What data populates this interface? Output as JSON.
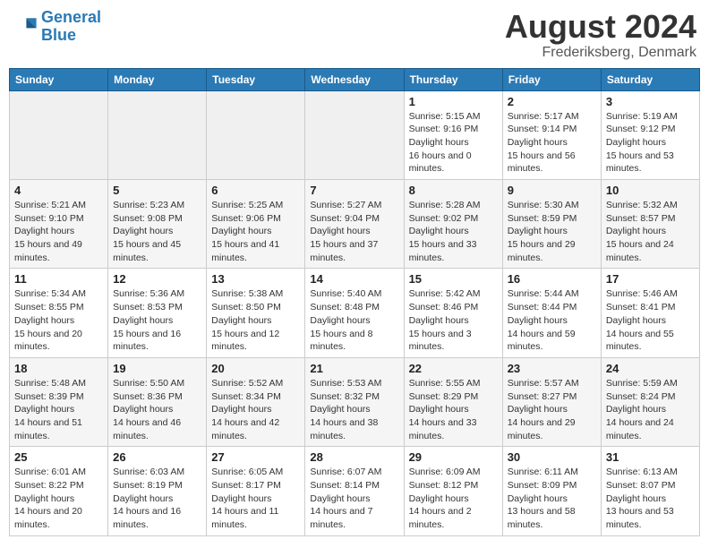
{
  "header": {
    "logo_line1": "General",
    "logo_line2": "Blue",
    "title": "August 2024",
    "subtitle": "Frederiksberg, Denmark"
  },
  "days_of_week": [
    "Sunday",
    "Monday",
    "Tuesday",
    "Wednesday",
    "Thursday",
    "Friday",
    "Saturday"
  ],
  "weeks": [
    [
      {
        "day": "",
        "empty": true
      },
      {
        "day": "",
        "empty": true
      },
      {
        "day": "",
        "empty": true
      },
      {
        "day": "",
        "empty": true
      },
      {
        "day": "1",
        "sunrise": "5:15 AM",
        "sunset": "9:16 PM",
        "daylight": "16 hours and 0 minutes."
      },
      {
        "day": "2",
        "sunrise": "5:17 AM",
        "sunset": "9:14 PM",
        "daylight": "15 hours and 56 minutes."
      },
      {
        "day": "3",
        "sunrise": "5:19 AM",
        "sunset": "9:12 PM",
        "daylight": "15 hours and 53 minutes."
      }
    ],
    [
      {
        "day": "4",
        "sunrise": "5:21 AM",
        "sunset": "9:10 PM",
        "daylight": "15 hours and 49 minutes."
      },
      {
        "day": "5",
        "sunrise": "5:23 AM",
        "sunset": "9:08 PM",
        "daylight": "15 hours and 45 minutes."
      },
      {
        "day": "6",
        "sunrise": "5:25 AM",
        "sunset": "9:06 PM",
        "daylight": "15 hours and 41 minutes."
      },
      {
        "day": "7",
        "sunrise": "5:27 AM",
        "sunset": "9:04 PM",
        "daylight": "15 hours and 37 minutes."
      },
      {
        "day": "8",
        "sunrise": "5:28 AM",
        "sunset": "9:02 PM",
        "daylight": "15 hours and 33 minutes."
      },
      {
        "day": "9",
        "sunrise": "5:30 AM",
        "sunset": "8:59 PM",
        "daylight": "15 hours and 29 minutes."
      },
      {
        "day": "10",
        "sunrise": "5:32 AM",
        "sunset": "8:57 PM",
        "daylight": "15 hours and 24 minutes."
      }
    ],
    [
      {
        "day": "11",
        "sunrise": "5:34 AM",
        "sunset": "8:55 PM",
        "daylight": "15 hours and 20 minutes."
      },
      {
        "day": "12",
        "sunrise": "5:36 AM",
        "sunset": "8:53 PM",
        "daylight": "15 hours and 16 minutes."
      },
      {
        "day": "13",
        "sunrise": "5:38 AM",
        "sunset": "8:50 PM",
        "daylight": "15 hours and 12 minutes."
      },
      {
        "day": "14",
        "sunrise": "5:40 AM",
        "sunset": "8:48 PM",
        "daylight": "15 hours and 8 minutes."
      },
      {
        "day": "15",
        "sunrise": "5:42 AM",
        "sunset": "8:46 PM",
        "daylight": "15 hours and 3 minutes."
      },
      {
        "day": "16",
        "sunrise": "5:44 AM",
        "sunset": "8:44 PM",
        "daylight": "14 hours and 59 minutes."
      },
      {
        "day": "17",
        "sunrise": "5:46 AM",
        "sunset": "8:41 PM",
        "daylight": "14 hours and 55 minutes."
      }
    ],
    [
      {
        "day": "18",
        "sunrise": "5:48 AM",
        "sunset": "8:39 PM",
        "daylight": "14 hours and 51 minutes."
      },
      {
        "day": "19",
        "sunrise": "5:50 AM",
        "sunset": "8:36 PM",
        "daylight": "14 hours and 46 minutes."
      },
      {
        "day": "20",
        "sunrise": "5:52 AM",
        "sunset": "8:34 PM",
        "daylight": "14 hours and 42 minutes."
      },
      {
        "day": "21",
        "sunrise": "5:53 AM",
        "sunset": "8:32 PM",
        "daylight": "14 hours and 38 minutes."
      },
      {
        "day": "22",
        "sunrise": "5:55 AM",
        "sunset": "8:29 PM",
        "daylight": "14 hours and 33 minutes."
      },
      {
        "day": "23",
        "sunrise": "5:57 AM",
        "sunset": "8:27 PM",
        "daylight": "14 hours and 29 minutes."
      },
      {
        "day": "24",
        "sunrise": "5:59 AM",
        "sunset": "8:24 PM",
        "daylight": "14 hours and 24 minutes."
      }
    ],
    [
      {
        "day": "25",
        "sunrise": "6:01 AM",
        "sunset": "8:22 PM",
        "daylight": "14 hours and 20 minutes."
      },
      {
        "day": "26",
        "sunrise": "6:03 AM",
        "sunset": "8:19 PM",
        "daylight": "14 hours and 16 minutes."
      },
      {
        "day": "27",
        "sunrise": "6:05 AM",
        "sunset": "8:17 PM",
        "daylight": "14 hours and 11 minutes."
      },
      {
        "day": "28",
        "sunrise": "6:07 AM",
        "sunset": "8:14 PM",
        "daylight": "14 hours and 7 minutes."
      },
      {
        "day": "29",
        "sunrise": "6:09 AM",
        "sunset": "8:12 PM",
        "daylight": "14 hours and 2 minutes."
      },
      {
        "day": "30",
        "sunrise": "6:11 AM",
        "sunset": "8:09 PM",
        "daylight": "13 hours and 58 minutes."
      },
      {
        "day": "31",
        "sunrise": "6:13 AM",
        "sunset": "8:07 PM",
        "daylight": "13 hours and 53 minutes."
      }
    ]
  ],
  "labels": {
    "sunrise": "Sunrise:",
    "sunset": "Sunset:",
    "daylight": "Daylight hours"
  }
}
